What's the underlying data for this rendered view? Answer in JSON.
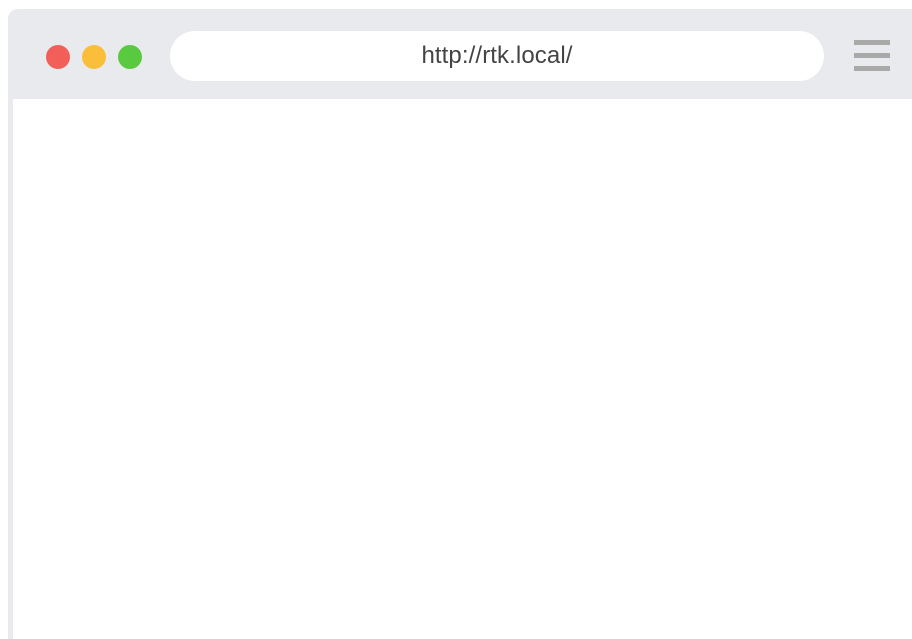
{
  "browser": {
    "address_bar": {
      "url": "http://rtk.local/"
    },
    "traffic_lights": {
      "close_color": "#f25f58",
      "minimize_color": "#fbbe3a",
      "maximize_color": "#59c940"
    },
    "menu_icon": "hamburger-menu-icon",
    "chrome_color": "#e9eaed",
    "content": ""
  }
}
